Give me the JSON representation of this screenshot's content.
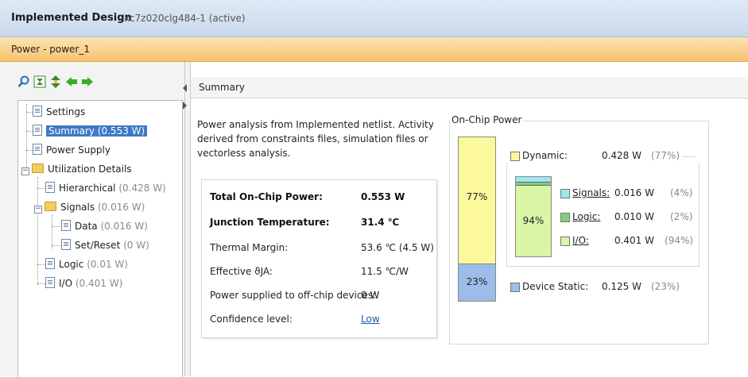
{
  "window": {
    "title": "Implemented Design",
    "subtitle": "- xc7z020clg484-1  (active)"
  },
  "tab": {
    "label": "Power - power_1"
  },
  "toolbar": {
    "icons": [
      "search-icon",
      "collapse-all-icon",
      "expand-all-icon",
      "back-arrow-icon",
      "forward-arrow-icon"
    ]
  },
  "tree": {
    "settings": "Settings",
    "summary": "Summary (0.553 W)",
    "power_supply": "Power Supply",
    "utilization": "Utilization Details",
    "hierarchical": {
      "label": "Hierarchical",
      "value": "(0.428 W)"
    },
    "signals": {
      "label": "Signals",
      "value": "(0.016 W)"
    },
    "data": {
      "label": "Data",
      "value": "(0.016 W)"
    },
    "setreset": {
      "label": "Set/Reset",
      "value": "(0 W)"
    },
    "logic": {
      "label": "Logic",
      "value": "(0.01 W)"
    },
    "io": {
      "label": "I/O",
      "value": "(0.401 W)"
    }
  },
  "summary": {
    "header": "Summary",
    "description": "Power analysis from Implemented netlist. Activity derived from constraints files, simulation files or vectorless analysis.",
    "rows": [
      {
        "label": "Total On-Chip Power:",
        "value": "0.553 W"
      },
      {
        "label": "Junction Temperature:",
        "value": "31.4 ℃"
      },
      {
        "label": "Thermal Margin:",
        "value": "53.6 ℃ (4.5 W)"
      },
      {
        "label": "Effective ϑJA:",
        "value": "11.5 ℃/W"
      },
      {
        "label": "Power supplied to off-chip devices:",
        "value": "0 W"
      },
      {
        "label": "Confidence level:",
        "value": "Low"
      }
    ]
  },
  "onchip": {
    "title": "On-Chip Power",
    "bar": {
      "dynamic_pct": "77%",
      "static_pct": "23%",
      "dynamic_fraction": 0.77
    },
    "minibar": {
      "pct": "94%",
      "signals_fraction": 0.04,
      "logic_fraction": 0.02,
      "io_fraction": 0.94
    },
    "dynamic": {
      "label": "Dynamic:",
      "value": "0.428 W",
      "pct": "(77%)"
    },
    "signals": {
      "label": "Signals:",
      "value": "0.016 W",
      "pct": "(4%)"
    },
    "logic": {
      "label": "Logic:",
      "value": "0.010 W",
      "pct": "(2%)"
    },
    "io": {
      "label": "I/O:",
      "value": "0.401 W",
      "pct": "(94%)"
    },
    "static": {
      "label": "Device Static:",
      "value": "0.125 W",
      "pct": "(23%)"
    },
    "colors": {
      "dynamic": "#fcf99c",
      "static": "#9dbde8",
      "signals": "#9ee7f0",
      "logic": "#7dd07d",
      "io": "#d8f6a6"
    }
  }
}
